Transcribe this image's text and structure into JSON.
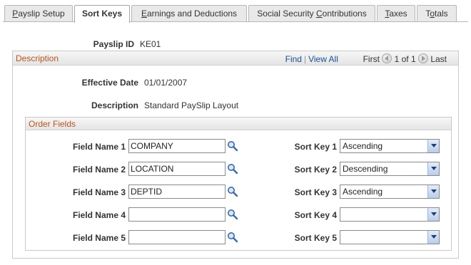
{
  "tabs": [
    {
      "pre": "",
      "ul": "P",
      "post": "ayslip Setup",
      "active": false
    },
    {
      "pre": "Sort Keys",
      "ul": "",
      "post": "",
      "active": true
    },
    {
      "pre": "",
      "ul": "E",
      "post": "arnings and Deductions",
      "active": false
    },
    {
      "pre": "Social Security ",
      "ul": "C",
      "post": "ontributions",
      "active": false
    },
    {
      "pre": "",
      "ul": "T",
      "post": "axes",
      "active": false
    },
    {
      "pre": "T",
      "ul": "o",
      "post": "tals",
      "active": false
    }
  ],
  "payslip": {
    "label": "Payslip ID",
    "value": "KE01"
  },
  "description_box": {
    "title": "Description",
    "nav": {
      "find": "Find",
      "view_all": "View All",
      "first": "First",
      "count": "1 of 1",
      "last": "Last"
    },
    "effective_date": {
      "label": "Effective Date",
      "value": "01/01/2007"
    },
    "description": {
      "label": "Description",
      "value": "Standard PaySlip Layout"
    }
  },
  "order_fields": {
    "title": "Order Fields",
    "rows": [
      {
        "field_label": "Field Name 1",
        "field_value": "COMPANY",
        "sort_label": "Sort Key 1",
        "sort_value": "Ascending"
      },
      {
        "field_label": "Field Name 2",
        "field_value": "LOCATION",
        "sort_label": "Sort Key 2",
        "sort_value": "Descending"
      },
      {
        "field_label": "Field Name 3",
        "field_value": "DEPTID",
        "sort_label": "Sort Key 3",
        "sort_value": "Ascending"
      },
      {
        "field_label": "Field Name 4",
        "field_value": "",
        "sort_label": "Sort Key 4",
        "sort_value": ""
      },
      {
        "field_label": "Field Name 5",
        "field_value": "",
        "sort_label": "Sort Key 5",
        "sort_value": ""
      }
    ]
  },
  "icons": {
    "lookup": "magnifier-icon",
    "dropdown": "chevron-down-icon",
    "prev": "previous-arrow-icon",
    "next": "next-arrow-icon"
  },
  "colors": {
    "group_title": "#b9541e",
    "link": "#1d4f91"
  }
}
